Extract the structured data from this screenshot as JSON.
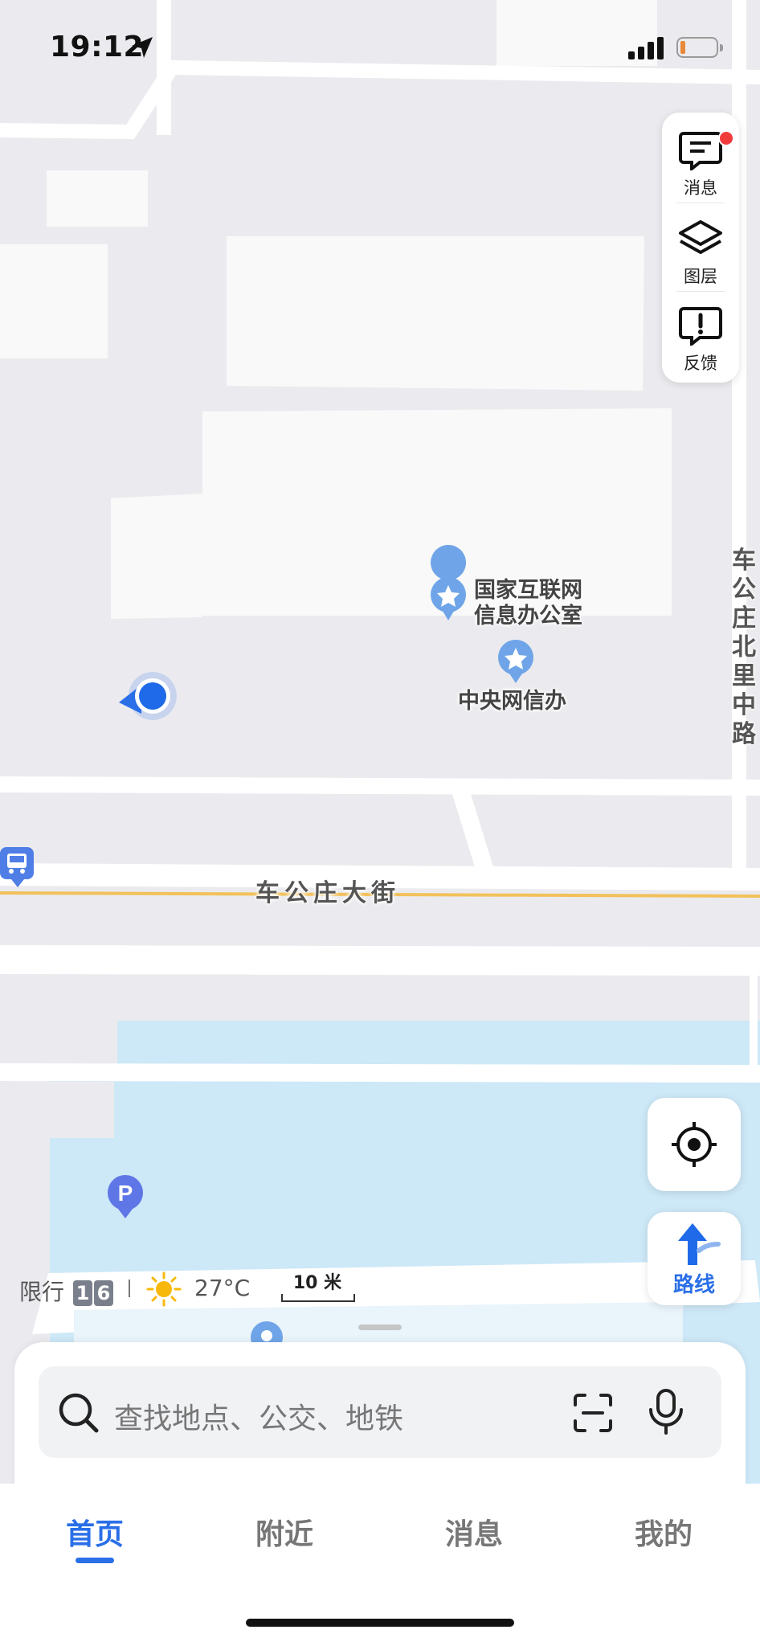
{
  "status_bar": {
    "time": "19:12"
  },
  "map": {
    "poi_labels": [
      "国家互联网",
      "信息办公室",
      "中央网信办"
    ],
    "road_horizontal": "车公庄大街",
    "road_vertical": [
      "车",
      "公",
      "庄",
      "北",
      "里",
      "中",
      "路"
    ]
  },
  "side_panel": {
    "messages_label": "消息",
    "layers_label": "图层",
    "feedback_label": "反馈"
  },
  "route_button": {
    "label": "路线"
  },
  "info_bar": {
    "restriction_label": "限行",
    "restriction_digits": [
      "1",
      "6"
    ],
    "temperature": "27°C",
    "scale": "10 米"
  },
  "search": {
    "placeholder": "查找地点、公交、地铁"
  },
  "tabs": [
    {
      "label": "首页"
    },
    {
      "label": "附近"
    },
    {
      "label": "消息"
    },
    {
      "label": "我的"
    }
  ],
  "colors": {
    "accent": "#2a6fe8",
    "road_yellow": "#f2c15a",
    "water": "#cde8f7",
    "notification": "#f23b3b"
  }
}
